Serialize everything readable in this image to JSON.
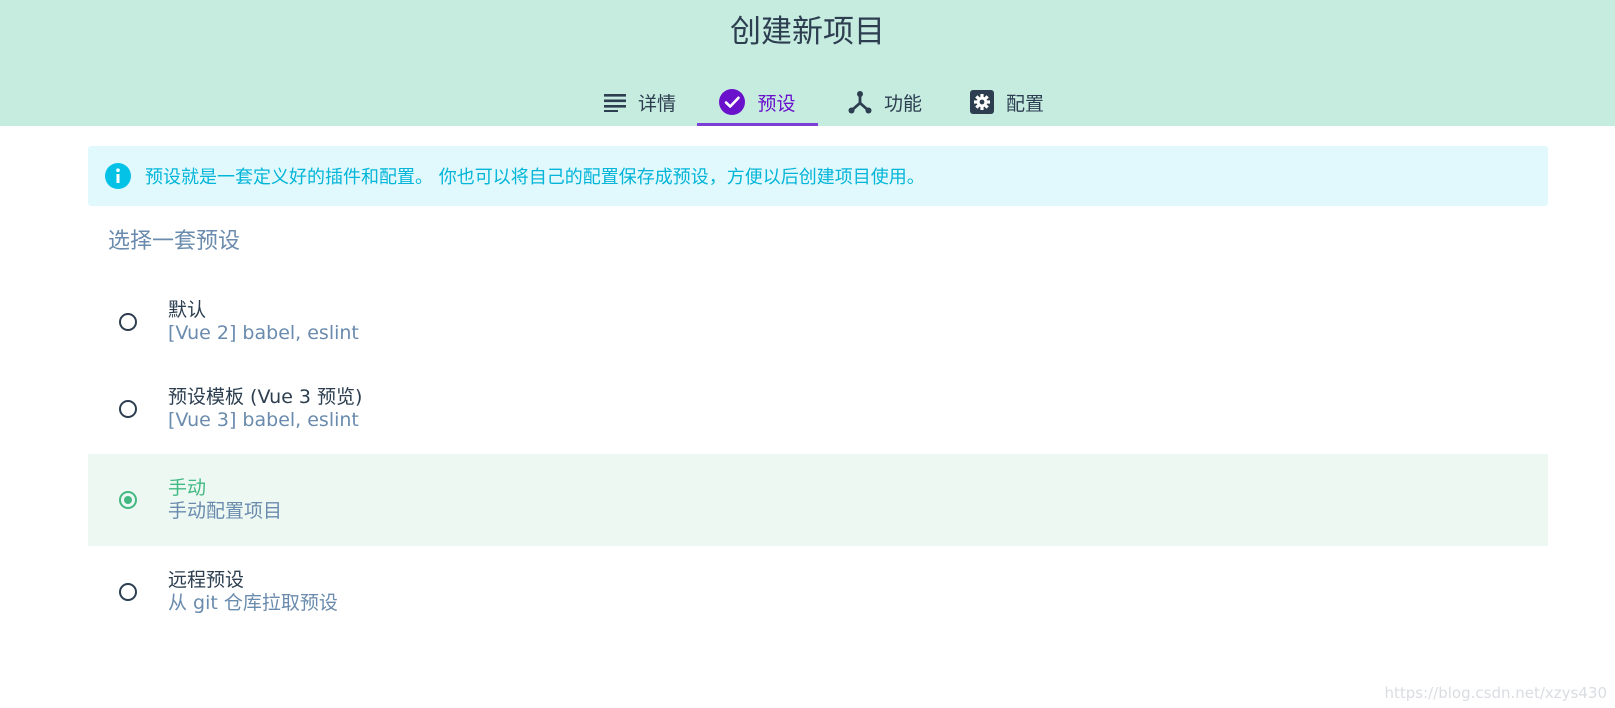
{
  "header": {
    "title": "创建新项目",
    "background": "#c6ebdf",
    "tabs": [
      {
        "label": "详情",
        "icon": "list-icon",
        "active": false
      },
      {
        "label": "预设",
        "icon": "check-circle-icon",
        "active": true
      },
      {
        "label": "功能",
        "icon": "fork-icon",
        "active": false
      },
      {
        "label": "配置",
        "icon": "gear-icon",
        "active": false
      }
    ],
    "active_color": "#6a11cb"
  },
  "info": {
    "icon": "info-icon",
    "text": "预设就是一套定义好的插件和配置。 你也可以将自己的配置保存成预设，方便以后创建项目使用。",
    "color": "#03b5d8",
    "background": "#e1f9fd"
  },
  "presets": {
    "title": "选择一套预设",
    "options": [
      {
        "name": "默认",
        "description": "[Vue 2] babel, eslint",
        "selected": false
      },
      {
        "name": "预设模板 (Vue 3 预览)",
        "description": "[Vue 3] babel, eslint",
        "selected": false
      },
      {
        "name": "手动",
        "description": "手动配置项目",
        "selected": true
      },
      {
        "name": "远程预设",
        "description": "从 git 仓库拉取预设",
        "selected": false
      }
    ],
    "selected_color": "#42b983"
  },
  "watermark": "https://blog.csdn.net/xzys430"
}
